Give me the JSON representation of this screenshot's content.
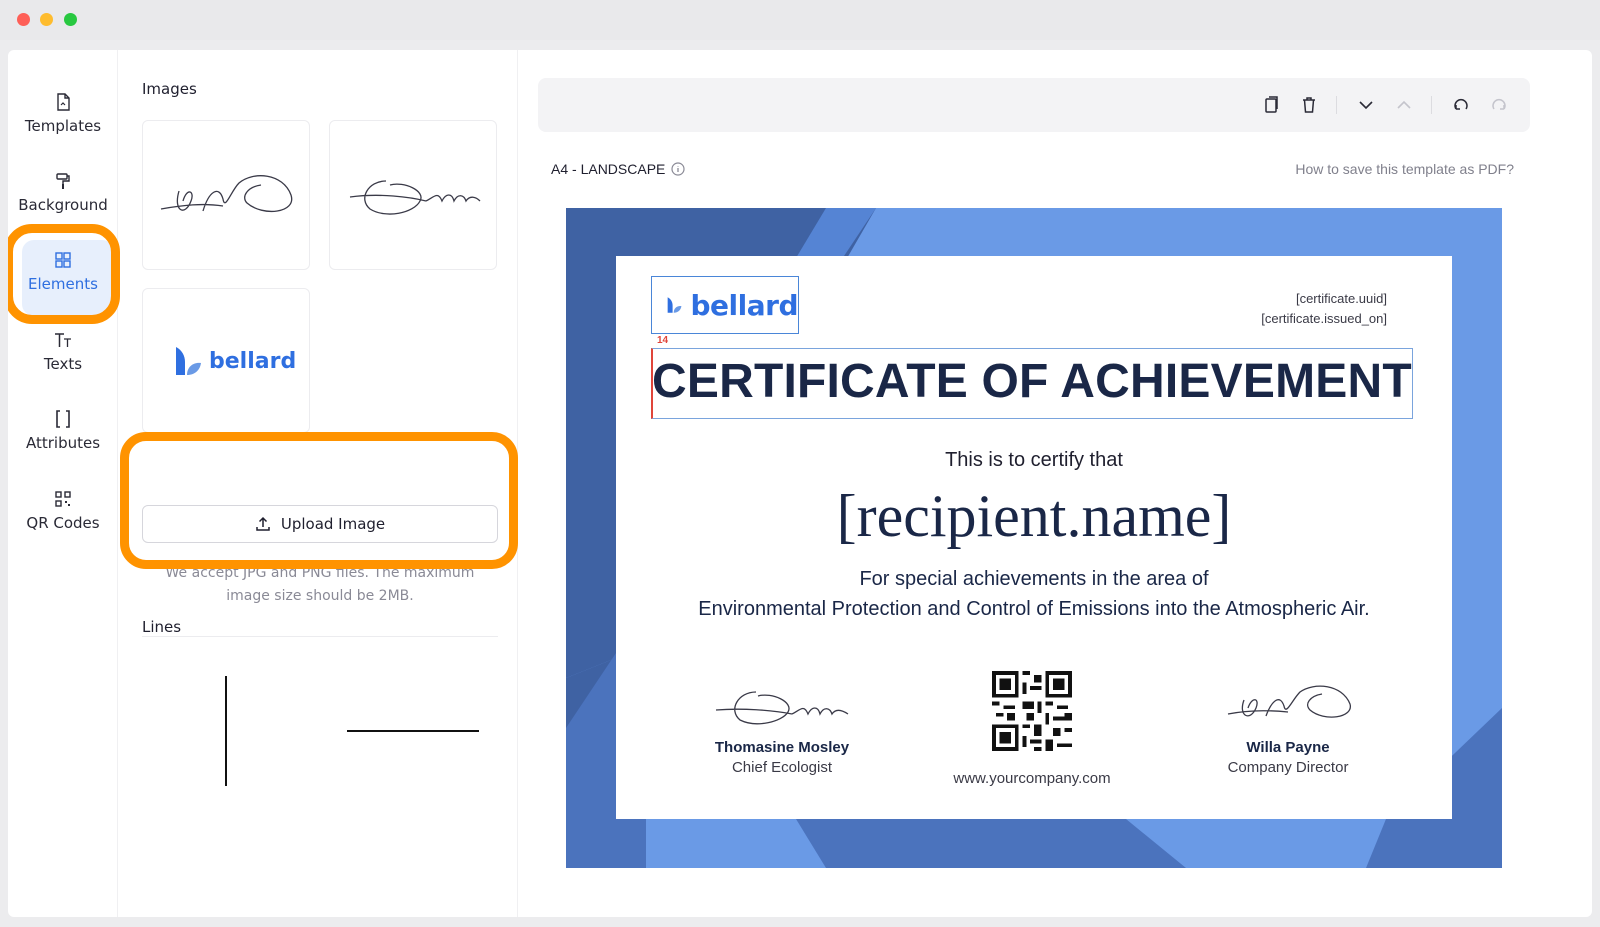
{
  "sidebar": {
    "items": [
      {
        "label": "Templates",
        "icon": "template-file-icon"
      },
      {
        "label": "Background",
        "icon": "paint-roller-icon"
      },
      {
        "label": "Elements",
        "icon": "elements-grid-icon",
        "active": true
      },
      {
        "label": "Texts",
        "icon": "text-icon"
      },
      {
        "label": "Attributes",
        "icon": "brackets-icon"
      },
      {
        "label": "QR Codes",
        "icon": "qr-code-icon"
      }
    ]
  },
  "panel": {
    "images_title": "Images",
    "upload_label": "Upload Image",
    "upload_note": "We accept JPG and PNG files. The maximum image size should be 2MB.",
    "lines_title": "Lines",
    "logo_text": "bellard"
  },
  "canvas": {
    "page_size": "A4 - LANDSCAPE",
    "help_link": "How to save this template as PDF?"
  },
  "certificate": {
    "logo_text": "bellard",
    "uuid": "[certificate.uuid]",
    "issued_on": "[certificate.issued_on]",
    "font_size_badge": "14",
    "title": "CERTIFICATE OF ACHIEVEMENT",
    "certify_line": "This is to certify that",
    "recipient": "[recipient.name]",
    "area_line1": "For special achievements in the area of",
    "area_line2": "Environmental Protection and Control of Emissions into the Atmospheric Air.",
    "left_signer": {
      "name": "Thomasine Mosley",
      "role": "Chief Ecologist"
    },
    "right_signer": {
      "name": "Willa Payne",
      "role": "Company Director"
    },
    "website": "www.yourcompany.com"
  },
  "colors": {
    "accent": "#2f6fe0",
    "highlight": "#ff9300",
    "frame_dark": "#3f62a3",
    "frame_light": "#6a9ae6",
    "title": "#1a2747"
  }
}
